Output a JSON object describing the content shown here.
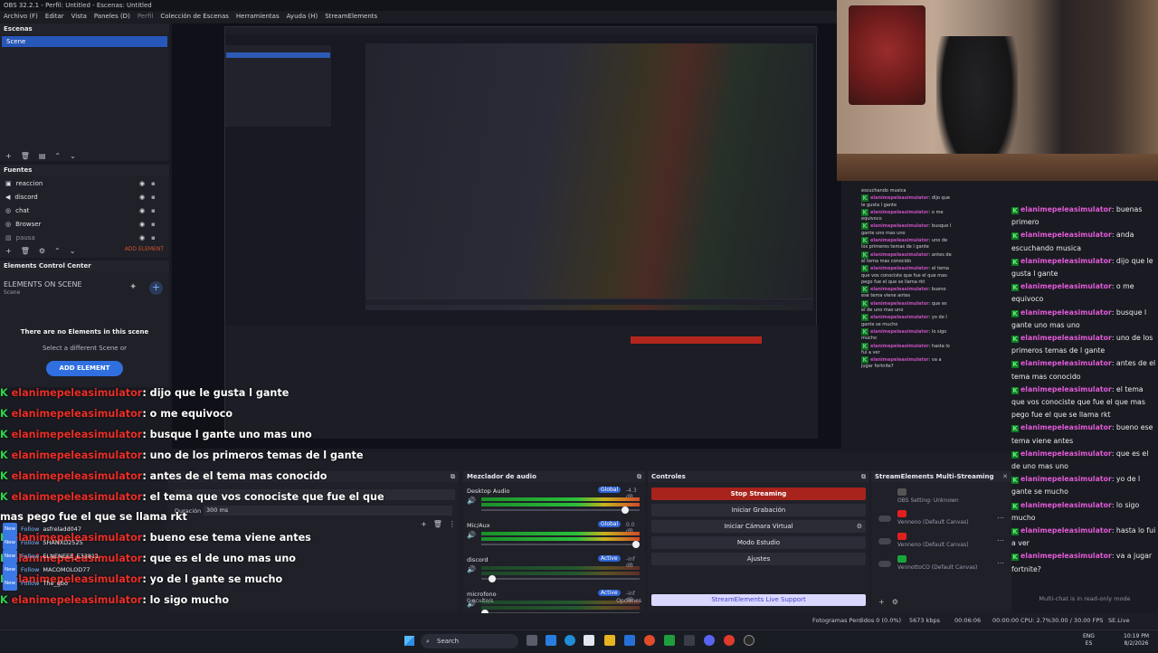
{
  "window": {
    "title": "OBS 32.2.1 - Perfil: Untitled - Escenas: Untitled"
  },
  "menu": [
    "Archivo (F)",
    "Editar",
    "Vista",
    "Paneles (D)",
    "Perfil",
    "Colección de Escenas",
    "Herramientas",
    "Ayuda (H)",
    "StreamElements"
  ],
  "scenes": {
    "header": "Escenas",
    "items": [
      "Scene"
    ]
  },
  "sources": {
    "header": "Fuentes",
    "items": [
      "reaccion",
      "discord",
      "chat",
      "Browser",
      "pausa"
    ],
    "add_element": "ADD ELEMENT"
  },
  "ecc": {
    "header": "Elements Control Center",
    "on_scene": "ELEMENTS ON SCENE",
    "scene": "Scene",
    "none": "There are no Elements in this scene",
    "select": "Select a different Scene or",
    "button": "ADD ELEMENT"
  },
  "chat_overlay": [
    {
      "user": "elanimepeleasimulator",
      "msg": ": dijo que le gusta l gante"
    },
    {
      "user": "elanimepeleasimulator",
      "msg": ": o me equivoco"
    },
    {
      "user": "elanimepeleasimulator",
      "msg": ": busque l gante uno mas uno"
    },
    {
      "user": "elanimepeleasimulator",
      "msg": ": uno de los primeros temas de l gante"
    },
    {
      "user": "elanimepeleasimulator",
      "msg": ": antes de el tema mas conocido"
    },
    {
      "user": "elanimepeleasimulator",
      "msg": ": el tema que vos conociste que fue el que"
    },
    {
      "user": "",
      "msg": "mas pego fue el que se llama rkt"
    },
    {
      "user": "elanimepeleasimulator",
      "msg": ": bueno ese tema viene antes"
    },
    {
      "user": "elanimepeleasimulator",
      "msg": ": que es el de uno mas uno"
    },
    {
      "user": "elanimepeleasimulator",
      "msg": ": yo de l gante se mucho"
    },
    {
      "user": "elanimepeleasimulator",
      "msg": ": lo sigo mucho"
    },
    {
      "user": "elanimepeleasimulator",
      "msg": ": hasta lo fui a ver"
    },
    {
      "user": "elanimepeleasimulator",
      "msg": ": va a jugar fortnite?"
    }
  ],
  "follows": {
    "badge": "New",
    "label": "Follow",
    "names": [
      "asfreladd047",
      "SHANXD2525",
      "ELNENEEE_E33811",
      "MACOMOLOD77",
      "The_gbo"
    ]
  },
  "chat_right": [
    {
      "user": "elanimepeleasimulator",
      "msg": ": buenas primero"
    },
    {
      "user": "elanimepeleasimulator",
      "msg": ": anda escuchando musica"
    },
    {
      "user": "elanimepeleasimulator",
      "msg": ": dijo que le gusta l gante"
    },
    {
      "user": "elanimepeleasimulator",
      "msg": ": o me equivoco"
    },
    {
      "user": "elanimepeleasimulator",
      "msg": ": busque l gante uno mas uno"
    },
    {
      "user": "elanimepeleasimulator",
      "msg": ": uno de los primeros temas de l gante"
    },
    {
      "user": "elanimepeleasimulator",
      "msg": ": antes de el tema mas conocido"
    },
    {
      "user": "elanimepeleasimulator",
      "msg": ": el tema que vos conociste que fue el que mas pego fue el que se llama rkt"
    },
    {
      "user": "elanimepeleasimulator",
      "msg": ": bueno ese tema viene antes"
    },
    {
      "user": "elanimepeleasimulator",
      "msg": ": que es el de uno mas uno"
    },
    {
      "user": "elanimepeleasimulator",
      "msg": ": yo de l gante se mucho"
    },
    {
      "user": "elanimepeleasimulator",
      "msg": ": lo sigo mucho"
    },
    {
      "user": "elanimepeleasimulator",
      "msg": ": hasta lo fui a ver"
    },
    {
      "user": "elanimepeleasimulator",
      "msg": ": va a jugar fortnite?"
    }
  ],
  "chat_mid": [
    {
      "user": "",
      "msg": "escuchando musica"
    },
    {
      "user": "elanimepeleasimulator",
      "msg": ": dijo que le gusta l gante"
    },
    {
      "user": "elanimepeleasimulator",
      "msg": ": o me equivoco"
    },
    {
      "user": "elanimepeleasimulator",
      "msg": ": busque l gante uno mas uno"
    },
    {
      "user": "elanimepeleasimulator",
      "msg": ": uno de los primeros temas de l gante"
    },
    {
      "user": "elanimepeleasimulator",
      "msg": ": antes de el tema mas conocido"
    },
    {
      "user": "elanimepeleasimulator",
      "msg": ": el tema que vos conociste que fue el que mas pego fue el que se llama rkt"
    },
    {
      "user": "elanimepeleasimulator",
      "msg": ": bueno ese tema viene antes"
    },
    {
      "user": "elanimepeleasimulator",
      "msg": ": que es el de uno mas uno"
    },
    {
      "user": "elanimepeleasimulator",
      "msg": ": yo de l gante se mucho"
    },
    {
      "user": "elanimepeleasimulator",
      "msg": ": lo sigo mucho"
    },
    {
      "user": "elanimepeleasimulator",
      "msg": ": hasta lo fui a ver"
    },
    {
      "user": "elanimepeleasimulator",
      "msg": ": va a jugar fortnite?"
    }
  ],
  "readonly": "Multi-chat is in read-only mode",
  "transitions": {
    "duration_label": "Duración",
    "duration_value": "300 ms"
  },
  "mixer": {
    "header": "Mezclador de audio",
    "channels": [
      {
        "name": "Desktop Audio",
        "tag": "Global",
        "db": "-4.3 dB",
        "level": 0.93
      },
      {
        "name": "Mic/Aux",
        "tag": "Global",
        "db": "0.0 dB",
        "level": 1.0
      },
      {
        "name": "discord",
        "tag": "Active",
        "db": "-inf dB",
        "level": 0.05
      },
      {
        "name": "microfono",
        "tag": "Active",
        "db": "-inf dB",
        "level": 0.0
      }
    ],
    "hidden": "0 oculto/s",
    "options": "Opciones"
  },
  "controls": {
    "header": "Controles",
    "buttons": [
      "Stop Streaming",
      "Iniciar Grabación",
      "Iniciar Cámara Virtual",
      "Modo Estudio",
      "Ajustes"
    ],
    "support": "StreamElements Live Support"
  },
  "multi": {
    "header": "StreamElements Multi-Streaming",
    "items": [
      "OBS Setting: Unknown",
      "Venneno (Default Canvas)",
      "Venneno (Default Canvas)",
      "VennottoCO (Default Canvas)"
    ]
  },
  "status": {
    "dropped": "Fotogramas Perdidos 0 (0.0%)",
    "kbps": "5673 kbps",
    "time": "00:06:06",
    "time2": "00:00:00",
    "cpu": "CPU: 2.7%",
    "fps": "30.00 / 30.00 FPS",
    "live": "SE.Live 26.2.5.549"
  },
  "taskbar": {
    "search": "Search",
    "lang": "ENG",
    "region": "ES",
    "clock": "10:19 PM",
    "date": "8/2/2026"
  },
  "colors": {
    "accent": "#2f6fe0",
    "stop": "#a8231c",
    "chat_user_overlay": "#ea2f28",
    "chat_user_panel": "#e05ad6",
    "kick": "#2bd64a"
  }
}
